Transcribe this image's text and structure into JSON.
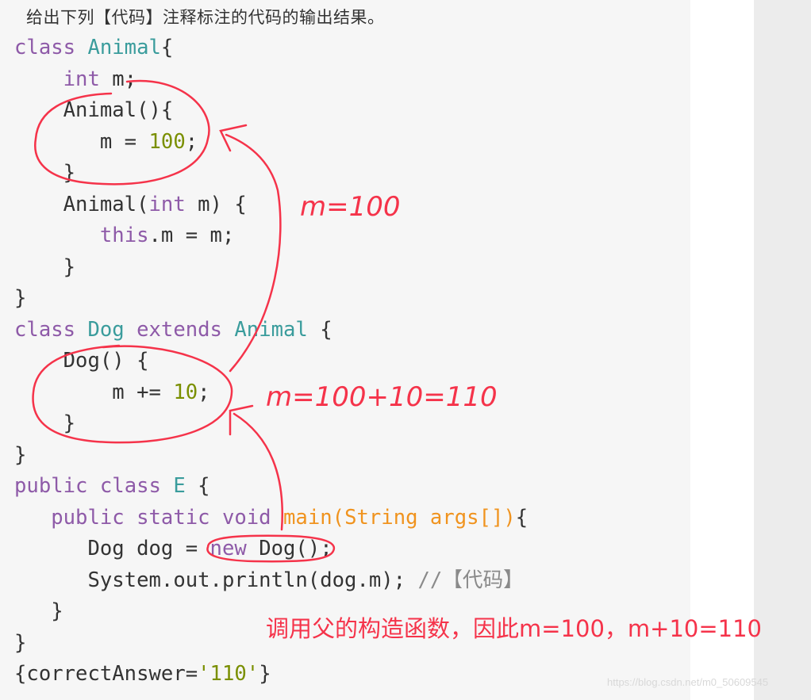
{
  "question": "给出下列【代码】注释标注的代码的输出结果。",
  "code_lines": [
    [
      [
        "class ",
        "kw"
      ],
      [
        "Animal",
        "cls"
      ],
      [
        "{",
        "pl"
      ]
    ],
    [
      [
        "    ",
        "pl"
      ],
      [
        "int",
        "kw"
      ],
      [
        " m;",
        "pl"
      ]
    ],
    [
      [
        "    Animal(){",
        "pl"
      ]
    ],
    [
      [
        "       m = ",
        "pl"
      ],
      [
        "100",
        "num"
      ],
      [
        ";",
        "pl"
      ]
    ],
    [
      [
        "    }",
        "pl"
      ]
    ],
    [
      [
        "    Animal(",
        "pl"
      ],
      [
        "int",
        "kw"
      ],
      [
        " m) {",
        "pl"
      ]
    ],
    [
      [
        "       ",
        "pl"
      ],
      [
        "this",
        "kw"
      ],
      [
        ".m = m;",
        "pl"
      ]
    ],
    [
      [
        "    }",
        "pl"
      ]
    ],
    [
      [
        "}",
        "pl"
      ]
    ],
    [
      [
        "class ",
        "kw"
      ],
      [
        "Dog",
        "cls"
      ],
      [
        " extends ",
        "kw"
      ],
      [
        "Animal",
        "cls"
      ],
      [
        " {",
        "pl"
      ]
    ],
    [
      [
        "    Dog() {",
        "pl"
      ]
    ],
    [
      [
        "        m += ",
        "pl"
      ],
      [
        "10",
        "num"
      ],
      [
        ";",
        "pl"
      ]
    ],
    [
      [
        "    }",
        "pl"
      ]
    ],
    [
      [
        "}",
        "pl"
      ]
    ],
    [
      [
        "public ",
        "kw"
      ],
      [
        "class ",
        "kw"
      ],
      [
        "E",
        "cls"
      ],
      [
        " {",
        "pl"
      ]
    ],
    [
      [
        "   ",
        "pl"
      ],
      [
        "public static void ",
        "kw"
      ],
      [
        "main",
        "fn"
      ],
      [
        "(String args[])",
        "fn"
      ],
      [
        "{",
        "pl"
      ]
    ],
    [
      [
        "      Dog dog = ",
        "pl"
      ],
      [
        "new",
        "kw"
      ],
      [
        " Dog();",
        "pl"
      ]
    ],
    [
      [
        "      System.out.println(dog.m); ",
        "pl"
      ],
      [
        "//【代码】",
        "cm"
      ]
    ],
    [
      [
        "   }",
        "pl"
      ]
    ],
    [
      [
        "}",
        "pl"
      ]
    ],
    [
      [
        "{correctAnswer=",
        "pl"
      ],
      [
        "'110'",
        "str"
      ],
      [
        "}",
        "pl"
      ]
    ]
  ],
  "annotations": {
    "handwritten_1": "m=100",
    "handwritten_2": "m=100+10=110",
    "note": "调用父的构造函数，因此m=100，m+10=110",
    "color": "#f5334a"
  },
  "watermark": "https://blog.csdn.net/m0_50609545"
}
